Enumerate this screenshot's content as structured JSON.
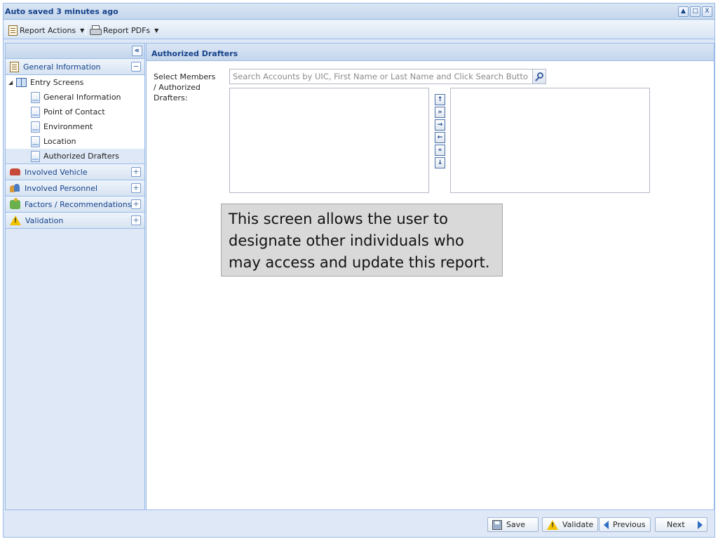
{
  "window": {
    "title": "Auto saved 3 minutes ago",
    "tools": [
      "▲",
      "□",
      "X"
    ]
  },
  "toolbar": {
    "report_actions_label": "Report Actions",
    "report_pdfs_label": "Report PDFs"
  },
  "sidebar": {
    "collapse_glyph": "«",
    "sections": [
      {
        "label": "General Information",
        "toggle": "−",
        "icon": "report-icon"
      },
      {
        "label": "Involved Vehicle",
        "toggle": "+",
        "icon": "vehicle-icon"
      },
      {
        "label": "Involved Personnel",
        "toggle": "+",
        "icon": "people-icon"
      },
      {
        "label": "Factors / Recommendations",
        "toggle": "+",
        "icon": "puzzle-icon"
      },
      {
        "label": "Validation",
        "toggle": "+",
        "icon": "warning-icon"
      }
    ],
    "tree": {
      "root_label": "Entry Screens",
      "items": [
        {
          "label": "General Information"
        },
        {
          "label": "Point of Contact"
        },
        {
          "label": "Environment"
        },
        {
          "label": "Location"
        },
        {
          "label": "Authorized Drafters",
          "selected": true
        }
      ]
    }
  },
  "main": {
    "title": "Authorized Drafters",
    "field_label": "Select Members / Authorized Drafters:",
    "search_placeholder": "Search Accounts by UIC, First Name or Last Name and Click Search Button",
    "arrow_buttons": [
      "↑",
      "»",
      "→",
      "←",
      "«",
      "↓"
    ]
  },
  "callout": {
    "text": "This screen allows the user to designate other individuals who may access and update this report."
  },
  "footer": {
    "save_label": "Save",
    "validate_label": "Validate",
    "previous_label": "Previous",
    "next_label": "Next"
  }
}
